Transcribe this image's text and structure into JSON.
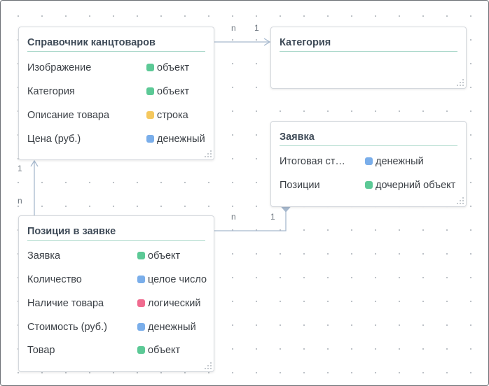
{
  "colors": {
    "object": "#5cc996",
    "string": "#f5c85e",
    "money": "#7aaeea",
    "integer": "#7aaeea",
    "boolean": "#f06b8f",
    "child": "#5cc996",
    "link": "#a7b9ce"
  },
  "entities": {
    "catalog": {
      "title": "Справочник канцтоваров",
      "fields": [
        {
          "name": "Изображение",
          "type": "объект"
        },
        {
          "name": "Категория",
          "type": "объект"
        },
        {
          "name": "Описание товара",
          "type": "строка"
        },
        {
          "name": "Цена (руб.)",
          "type": "денежный"
        }
      ]
    },
    "category": {
      "title": "Категория",
      "fields": []
    },
    "order": {
      "title": "Заявка",
      "fields": [
        {
          "name": "Итоговая ст…",
          "type": "денежный"
        },
        {
          "name": "Позиции",
          "type": "дочерний объект"
        }
      ]
    },
    "position": {
      "title": "Позиция в заявке",
      "fields": [
        {
          "name": "Заявка",
          "type": "объект"
        },
        {
          "name": "Количество",
          "type": "целое число"
        },
        {
          "name": "Наличие товара",
          "type": "логический"
        },
        {
          "name": "Стоимость (руб.)",
          "type": "денежный"
        },
        {
          "name": "Товар",
          "type": "объект"
        }
      ]
    }
  },
  "relations": {
    "catalog_category": {
      "from_label": "n",
      "to_label": "1"
    },
    "position_catalog": {
      "from_label": "n",
      "to_label": "1"
    },
    "position_order": {
      "from_label": "n",
      "to_label": "1"
    }
  }
}
